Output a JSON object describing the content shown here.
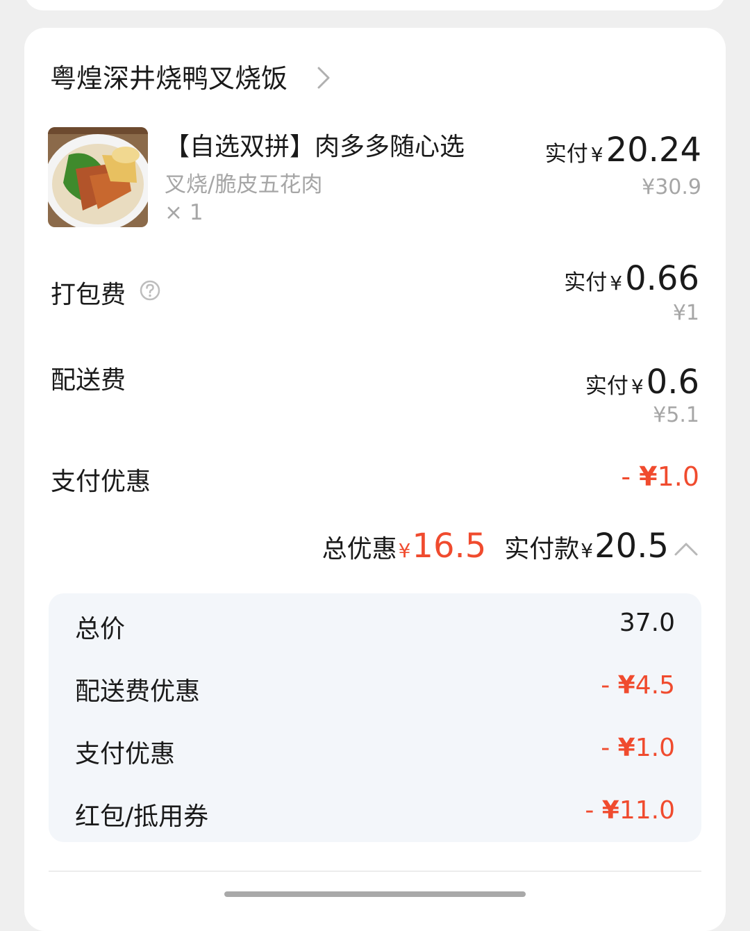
{
  "store": {
    "name": "粤煌深井烧鸭叉烧饭"
  },
  "item": {
    "name": "【自选双拼】肉多多随心选",
    "spec": "叉烧/脆皮五花肉",
    "qty": "× 1",
    "paid_label": "实付",
    "paid_yen": "¥",
    "paid_value": "20.24",
    "original_price": "¥30.9"
  },
  "packing_fee": {
    "label": "打包费",
    "paid_label": "实付",
    "paid_yen": "¥",
    "paid_value": "0.66",
    "original_price": "¥1"
  },
  "delivery_fee": {
    "label": "配送费",
    "paid_label": "实付",
    "paid_yen": "¥",
    "paid_value": "0.6",
    "original_price": "¥5.1"
  },
  "payment_discount": {
    "label": "支付优惠",
    "minus": "- ",
    "yen": "¥",
    "value": "1.0"
  },
  "summary": {
    "discount_label": "总优惠",
    "discount_yen": "¥",
    "discount_value": "16.5",
    "pay_label": "实付款",
    "pay_yen": "¥",
    "pay_value": "20.5"
  },
  "breakdown": {
    "total": {
      "label": "总价",
      "value": "37.0"
    },
    "delivery_discount": {
      "label": "配送费优惠",
      "minus": "- ",
      "yen": "¥",
      "value": "4.5"
    },
    "payment_discount": {
      "label": "支付优惠",
      "minus": "- ",
      "yen": "¥",
      "value": "1.0"
    },
    "coupon": {
      "label": "红包/抵用券",
      "minus": "- ",
      "yen": "¥",
      "value": "11.0"
    }
  },
  "colors": {
    "accent_red": "#f04b2e",
    "muted_gray": "#a6a6a6",
    "panel_bg": "#f3f6fa"
  }
}
